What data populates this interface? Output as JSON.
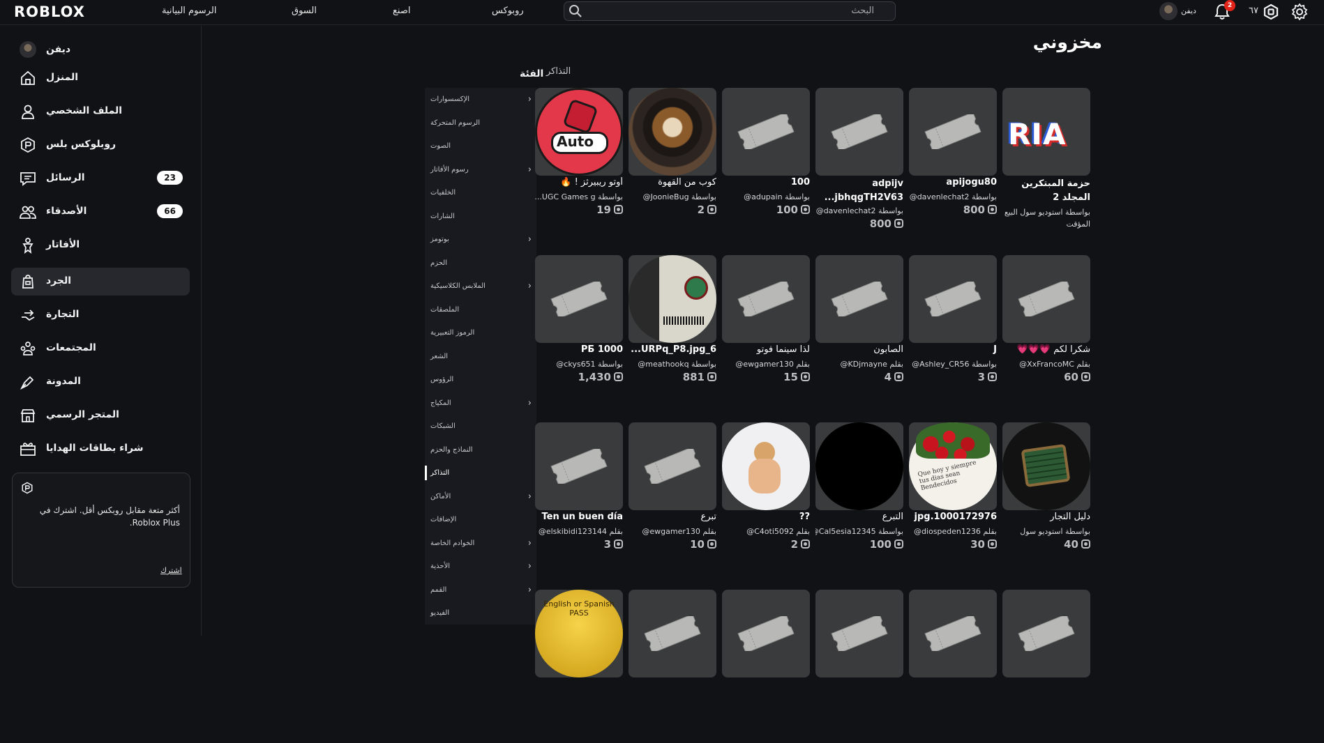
{
  "topbar": {
    "logo": "ROBLOX",
    "nav": [
      "الرسوم البيانية",
      "السوق",
      "اصنع",
      "روبوكس"
    ],
    "search_placeholder": "البحث",
    "username": "ديفن",
    "notif_count": "2",
    "robux": "٦٧"
  },
  "sidebar": {
    "user": "ديفن",
    "items": [
      {
        "label": "المنزل",
        "icon": "home-icon"
      },
      {
        "label": "الملف الشخصي",
        "icon": "profile-icon"
      },
      {
        "label": "روبلوكس بلس",
        "icon": "roblox-plus-icon"
      },
      {
        "label": "الرسائل",
        "icon": "messages-icon",
        "count": "23"
      },
      {
        "label": "الأصدقاء",
        "icon": "friends-icon",
        "count": "66"
      },
      {
        "label": "الأفاتار",
        "icon": "avatar-icon"
      },
      {
        "label": "الجرد",
        "icon": "inventory-icon",
        "active": true
      },
      {
        "label": "التجارة",
        "icon": "trade-icon"
      },
      {
        "label": "المجتمعات",
        "icon": "communities-icon"
      },
      {
        "label": "المدونة",
        "icon": "blog-icon"
      },
      {
        "label": "المتجر الرسمي",
        "icon": "store-icon"
      },
      {
        "label": "شراء بطاقات الهدايا",
        "icon": "gift-card-icon"
      }
    ],
    "promo_text": "أكثر متعة مقابل روبكس أقل. اشترك في Roblox Plus.",
    "promo_link": "اشترك"
  },
  "page": {
    "title": "مخزوني",
    "category_label": "الفئة",
    "current_tab": "التذاكر"
  },
  "categories": [
    {
      "label": "الإكسسوارات",
      "chev": true
    },
    {
      "label": "الرسوم المتحركة",
      "chev": false
    },
    {
      "label": "الصوت",
      "chev": false
    },
    {
      "label": "رسوم الأفاتار",
      "chev": true
    },
    {
      "label": "الخلفيات",
      "chev": false
    },
    {
      "label": "الشارات",
      "chev": false
    },
    {
      "label": "بوتومز",
      "chev": true
    },
    {
      "label": "الحزم",
      "chev": false
    },
    {
      "label": "الملابس الكلاسيكية",
      "chev": true
    },
    {
      "label": "الملصقات",
      "chev": false
    },
    {
      "label": "الرموز التعبيرية",
      "chev": false
    },
    {
      "label": "الشعر",
      "chev": false
    },
    {
      "label": "الرؤوس",
      "chev": false
    },
    {
      "label": "المكياج",
      "chev": true
    },
    {
      "label": "الشبكات",
      "chev": false
    },
    {
      "label": "النماذج والحزم",
      "chev": false
    },
    {
      "label": "التذاكر",
      "chev": false,
      "active": true
    },
    {
      "label": "الأماكن",
      "chev": true
    },
    {
      "label": "الإضافات",
      "chev": false
    },
    {
      "label": "الخوادم الخاصة",
      "chev": true
    },
    {
      "label": "الأحذية",
      "chev": true
    },
    {
      "label": "القمم",
      "chev": true
    },
    {
      "label": "الفيديو",
      "chev": false
    }
  ],
  "items": [
    {
      "name": "حزمة المبتكرين المجلد 2",
      "by": "بواسطة استوديو سول البيع المؤقت",
      "price": "",
      "thumb": "ria"
    },
    {
      "name": "apijogu80",
      "by": "بواسطة davenlechat2@",
      "price": "800",
      "thumb": "ticket"
    },
    {
      "name": "adpijv jbhqgTH2V63...",
      "by": "بواسطة davenlechat2@",
      "price": "800",
      "thumb": "ticket"
    },
    {
      "name": "100",
      "by": "بواسطة adupain@",
      "price": "100",
      "thumb": "ticket"
    },
    {
      "name": "كوب من القهوة",
      "by": "بواسطة JoonieBug@",
      "price": "2",
      "thumb": "coffee",
      "plain": true
    },
    {
      "name": "أوتو ريبيرثز ! 🔥",
      "by": "بواسطة UGC Games g...",
      "price": "19",
      "thumb": "auto",
      "plain": true
    },
    {
      "name": "شكرا لكم 💗💗💗",
      "by": "بقلم XxFrancoMC@",
      "price": "60",
      "thumb": "ticket",
      "plain": true
    },
    {
      "name": "J",
      "by": "بواسطة Ashley_CR56@",
      "price": "3",
      "thumb": "ticket"
    },
    {
      "name": "الصابون",
      "by": "بقلم KDjmayne@",
      "price": "4",
      "thumb": "ticket",
      "plain": true
    },
    {
      "name": "لذا سينما فوتو",
      "by": "بقلم ewgamer130@",
      "price": "15",
      "thumb": "ticket",
      "plain": true
    },
    {
      "name": "6_URPq_P8.jpg...",
      "by": "بواسطة meathookq@",
      "price": "881",
      "thumb": "id"
    },
    {
      "name": "1000 РБ",
      "by": "بواسطة ckys651@",
      "price": "1,430",
      "thumb": "ticket"
    },
    {
      "name": "دليل التجار",
      "by": "بواسطة استوديو سول",
      "price": "40",
      "thumb": "trader",
      "plain": true
    },
    {
      "name": "1000172976.jpg",
      "by": "بقلم diospeden1236@",
      "price": "30",
      "thumb": "roses"
    },
    {
      "name": "التبرع",
      "by": "بواسطة Cal5esia12345@",
      "price": "100",
      "thumb": "black",
      "plain": true
    },
    {
      "name": "??",
      "by": "بقلم C4oti5092@",
      "price": "2",
      "thumb": "fig"
    },
    {
      "name": "تبرع",
      "by": "بقلم ewgamer130@",
      "price": "10",
      "thumb": "ticket",
      "plain": true
    },
    {
      "name": "Ten un buen día",
      "by": "بقلم elskibidi123144@",
      "price": "3",
      "thumb": "ticket"
    },
    {
      "name": "",
      "by": "",
      "price": "",
      "thumb": "ticket"
    },
    {
      "name": "",
      "by": "",
      "price": "",
      "thumb": "ticket"
    },
    {
      "name": "",
      "by": "",
      "price": "",
      "thumb": "ticket"
    },
    {
      "name": "",
      "by": "",
      "price": "",
      "thumb": "ticket"
    },
    {
      "name": "",
      "by": "",
      "price": "",
      "thumb": "ticket"
    },
    {
      "name": "",
      "by": "",
      "price": "",
      "thumb": "pass",
      "pass_text": "English or Spanish PASS"
    }
  ]
}
